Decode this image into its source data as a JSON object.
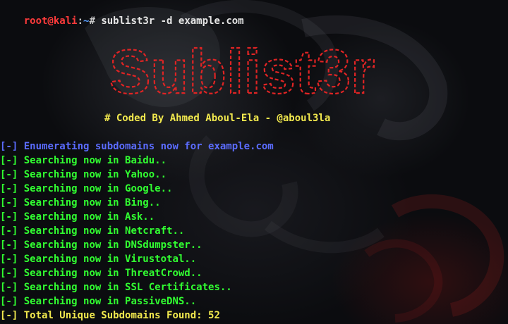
{
  "prompt": {
    "user_host": "root@kali",
    "separator": ":",
    "path": "~",
    "symbol": "# ",
    "command": "sublist3r -d example.com"
  },
  "banner": {
    "logo_text": "Sublist3r",
    "logo_color": "#e02424"
  },
  "credit": "# Coded By Ahmed Aboul-Ela - @aboul3la",
  "output": {
    "lines": [
      {
        "prefix": "[-]",
        "text": " Enumerating subdomains now for example.com",
        "color": "#5b6cff"
      },
      {
        "prefix": "[-]",
        "text": " Searching now in Baidu..",
        "color": "#31ff31"
      },
      {
        "prefix": "[-]",
        "text": " Searching now in Yahoo..",
        "color": "#31ff31"
      },
      {
        "prefix": "[-]",
        "text": " Searching now in Google..",
        "color": "#31ff31"
      },
      {
        "prefix": "[-]",
        "text": " Searching now in Bing..",
        "color": "#31ff31"
      },
      {
        "prefix": "[-]",
        "text": " Searching now in Ask..",
        "color": "#31ff31"
      },
      {
        "prefix": "[-]",
        "text": " Searching now in Netcraft..",
        "color": "#31ff31"
      },
      {
        "prefix": "[-]",
        "text": " Searching now in DNSdumpster..",
        "color": "#31ff31"
      },
      {
        "prefix": "[-]",
        "text": " Searching now in Virustotal..",
        "color": "#31ff31"
      },
      {
        "prefix": "[-]",
        "text": " Searching now in ThreatCrowd..",
        "color": "#31ff31"
      },
      {
        "prefix": "[-]",
        "text": " Searching now in SSL Certificates..",
        "color": "#31ff31"
      },
      {
        "prefix": "[-]",
        "text": " Searching now in PassiveDNS..",
        "color": "#31ff31"
      },
      {
        "prefix": "[-]",
        "text": " Total Unique Subdomains Found: 52",
        "color": "#f2e94e"
      }
    ]
  },
  "colors": {
    "background": "#0b0c0f",
    "info": "#5b6cff",
    "progress": "#31ff31",
    "result": "#f2e94e"
  }
}
